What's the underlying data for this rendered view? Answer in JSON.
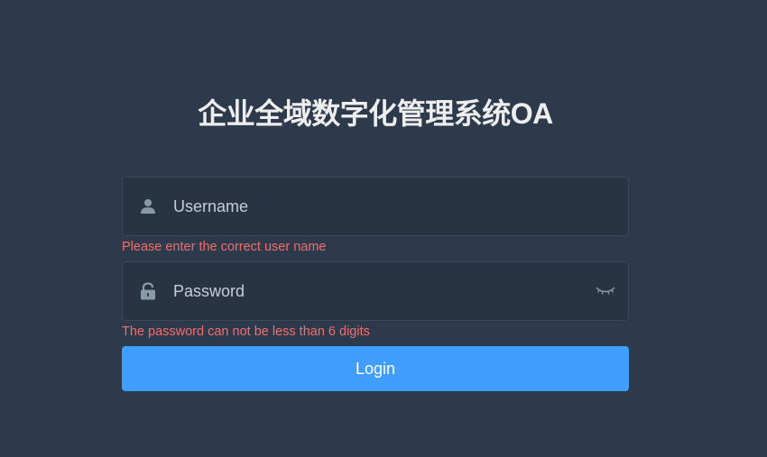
{
  "login": {
    "title": "企业全域数字化管理系统OA",
    "username": {
      "placeholder": "Username",
      "value": "",
      "icon": "user-icon",
      "error": "Please enter the correct user name"
    },
    "password": {
      "placeholder": "Password",
      "value": "",
      "icon": "lock-icon",
      "toggle_icon": "eye-closed-icon",
      "error": "The password can not be less than 6 digits"
    },
    "login_button": "Login"
  },
  "colors": {
    "background": "#2d3a4b",
    "accent": "#409eff",
    "error": "#f56c6c",
    "icon": "#889aa4"
  }
}
